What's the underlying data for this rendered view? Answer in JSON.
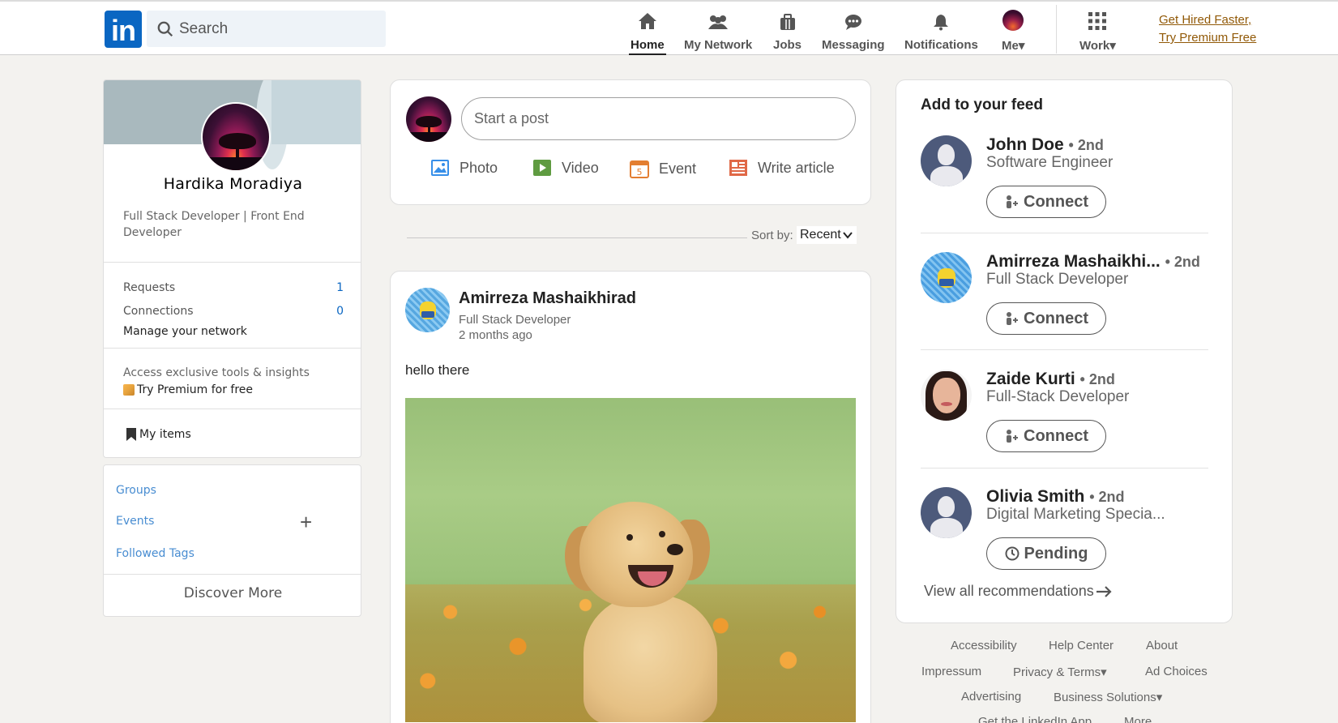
{
  "nav": {
    "logo_text": "in",
    "search_placeholder": "Search",
    "items": [
      {
        "label": "Home",
        "icon": "home-icon"
      },
      {
        "label": "My Network",
        "icon": "network-icon"
      },
      {
        "label": "Jobs",
        "icon": "briefcase-icon"
      },
      {
        "label": "Messaging",
        "icon": "chat-icon"
      },
      {
        "label": "Notifications",
        "icon": "bell-icon"
      },
      {
        "label": "Me▾",
        "icon": "avatar"
      },
      {
        "label": "Work▾",
        "icon": "grid-icon"
      }
    ],
    "premium_line1": "Get Hired Faster,",
    "premium_line2": "Try Premium Free"
  },
  "profile": {
    "name": "Hardika Moradiya",
    "headline": "Full Stack Developer | Front End Developer",
    "requests_label": "Requests",
    "requests_count": "1",
    "connections_label": "Connections",
    "connections_count": "0",
    "manage_label": "Manage your network",
    "access_text": "Access exclusive tools & insights",
    "premium_text": "Try Premium for free",
    "my_items": "My items"
  },
  "groups": {
    "groups_label": "Groups",
    "events_label": "Events",
    "tags_label": "Followed Tags",
    "plus": "+",
    "discover": "Discover More"
  },
  "share": {
    "placeholder": "Start a post",
    "photo": "Photo",
    "video": "Video",
    "event": "Event",
    "article": "Write article"
  },
  "sort": {
    "label": "Sort by:",
    "value": "Recent"
  },
  "post": {
    "author": "Amirreza Mashaikhirad",
    "subtitle": "Full Stack Developer",
    "time": "2 months ago",
    "text": "hello there"
  },
  "feed": {
    "title": "Add to your feed",
    "recommendations": [
      {
        "name": "John Doe",
        "degree": "• 2nd",
        "title": "Software Engineer",
        "button": "Connect"
      },
      {
        "name": "Amirreza Mashaikhi...",
        "degree": "• 2nd",
        "title": "Full Stack Developer",
        "button": "Connect"
      },
      {
        "name": "Zaide Kurti",
        "degree": "• 2nd",
        "title": "Full-Stack Developer",
        "button": "Connect"
      },
      {
        "name": "Olivia Smith",
        "degree": "• 2nd",
        "title": "Digital Marketing Specia...",
        "button": "Pending"
      }
    ],
    "view_all": "View all recommendations"
  },
  "footer": {
    "links": [
      "Accessibility",
      "Help Center",
      "About",
      "Impressum",
      "Privacy & Terms▾",
      "Ad Choices",
      "Advertising",
      "Business Solutions▾",
      "Get the LinkedIn App",
      "More"
    ]
  },
  "colors": {
    "brand": "#0a66c2",
    "premium": "#915907",
    "background": "#f3f2ef"
  }
}
